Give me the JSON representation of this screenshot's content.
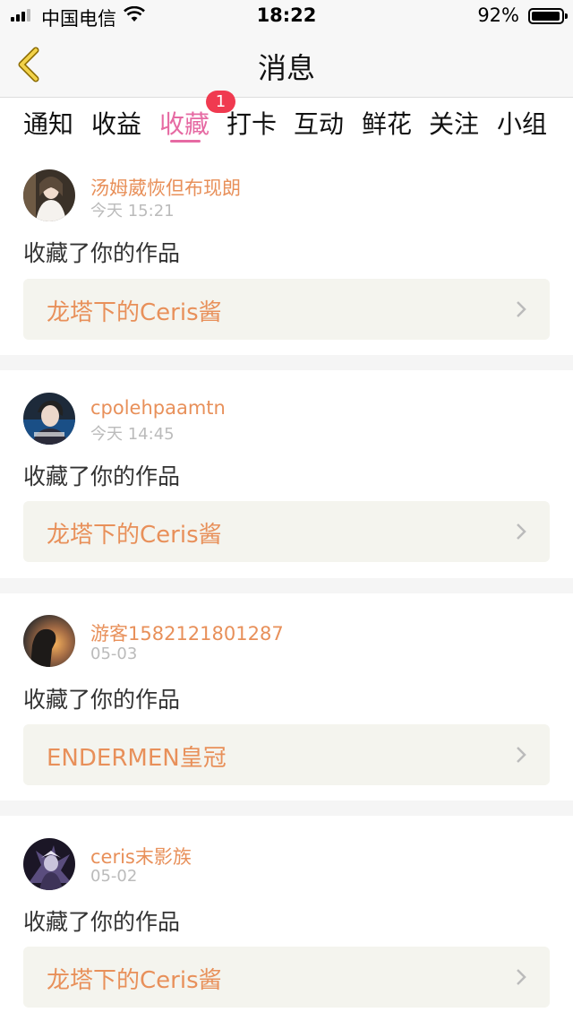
{
  "status": {
    "carrier": "中国电信",
    "time": "18:22",
    "battery": "92%",
    "battery_level": 0.92
  },
  "nav": {
    "title": "消息"
  },
  "tabs": [
    {
      "label": "通知"
    },
    {
      "label": "收益"
    },
    {
      "label": "收藏",
      "active": true
    },
    {
      "label": "打卡"
    },
    {
      "label": "互动"
    },
    {
      "label": "鲜花"
    },
    {
      "label": "关注"
    },
    {
      "label": "小组"
    }
  ],
  "badge": "1",
  "colors": {
    "accent_pink": "#e66aa3",
    "username_orange": "#e8905a",
    "badge_red": "#f03a50",
    "work_box_bg": "#f4f4ee"
  },
  "messages": [
    {
      "user": "汤姆葳恢但布现朗",
      "time": "今天 15:21",
      "action": "收藏了你的作品",
      "work": "龙塔下的Ceris酱",
      "avatar_icon": "avatar-portrait-girl"
    },
    {
      "user": "cpolehpaamtn",
      "time": "今天 14:45",
      "action": "收藏了你的作品",
      "work": "龙塔下的Ceris酱",
      "avatar_icon": "avatar-portrait-boy"
    },
    {
      "user": "游客1582121801287",
      "time": "05-03",
      "action": "收藏了你的作品",
      "work": "ENDERMEN皇冠",
      "avatar_icon": "avatar-silhouette-sunset"
    },
    {
      "user": "ceris末影族",
      "time": "05-02",
      "action": "收藏了你的作品",
      "work": "龙塔下的Ceris酱",
      "avatar_icon": "avatar-anime-character"
    }
  ]
}
